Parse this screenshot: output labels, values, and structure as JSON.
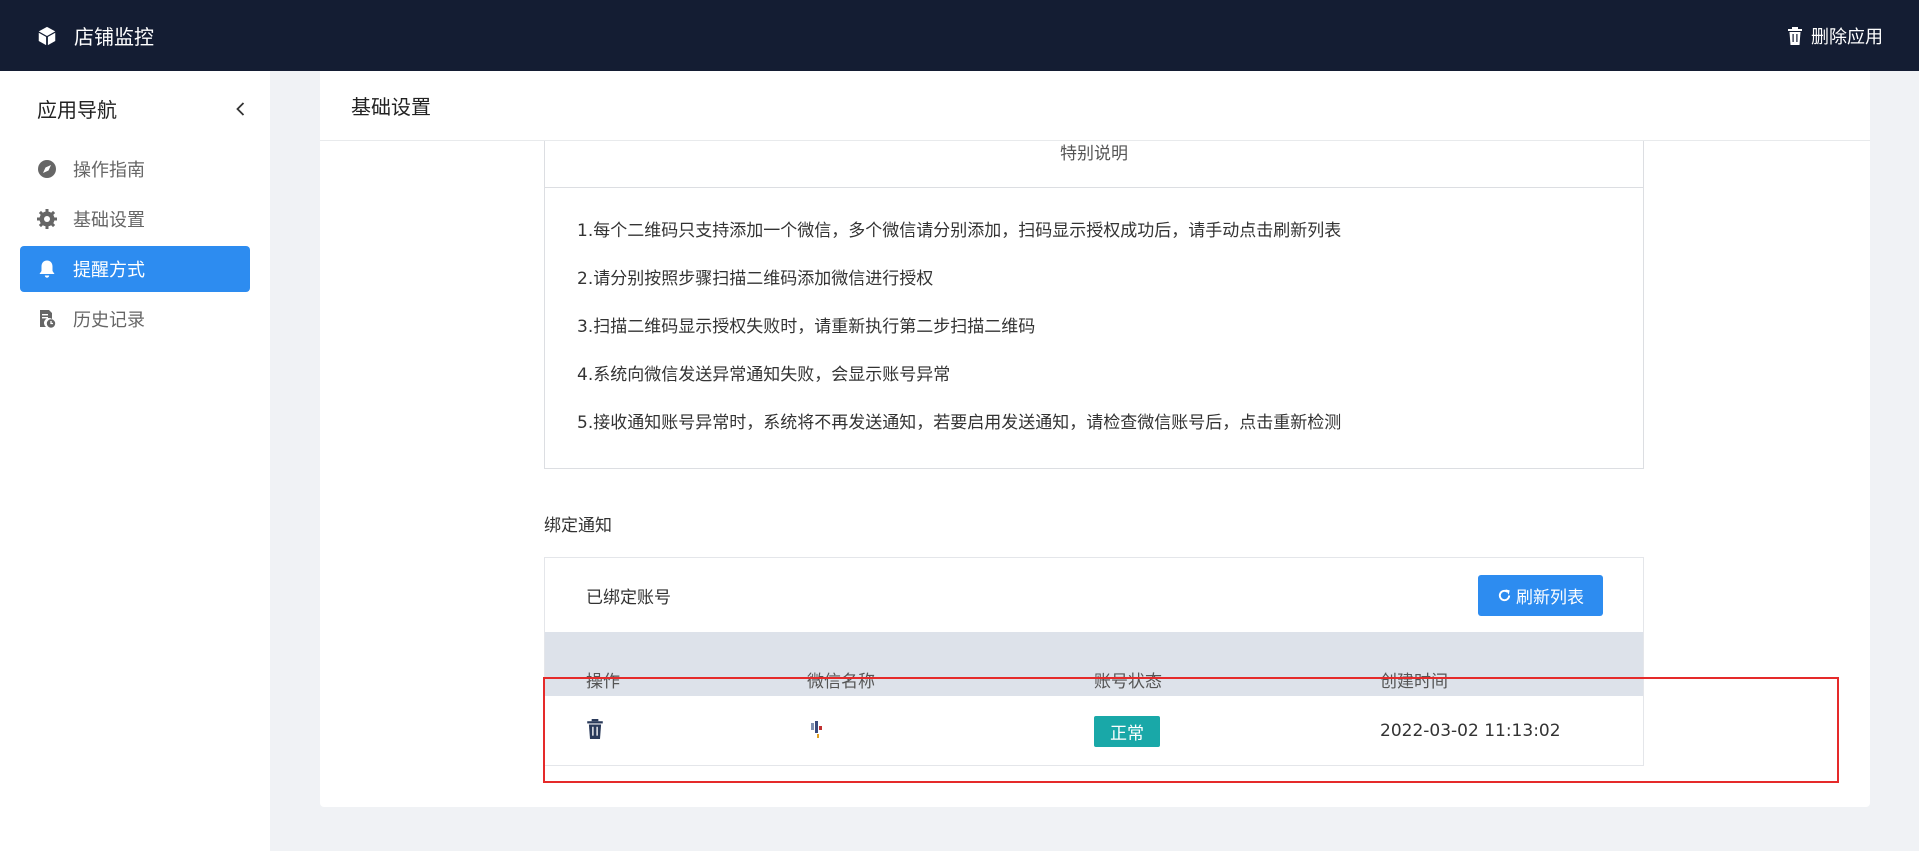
{
  "header": {
    "app_name": "店铺监控",
    "delete_app_label": "删除应用"
  },
  "sidebar": {
    "title": "应用导航",
    "items": [
      {
        "label": "操作指南",
        "icon": "navigation-icon"
      },
      {
        "label": "基础设置",
        "icon": "gear-icon"
      },
      {
        "label": "提醒方式",
        "icon": "bell-icon",
        "active": true
      },
      {
        "label": "历史记录",
        "icon": "history-doc-icon"
      }
    ]
  },
  "main": {
    "title": "基础设置",
    "notice": {
      "title": "特别说明",
      "lines": [
        "1.每个二维码只支持添加一个微信，多个微信请分别添加，扫码显示授权成功后，请手动点击刷新列表",
        "2.请分别按照步骤扫描二维码添加微信进行授权",
        "3.扫描二维码显示授权失败时，请重新执行第二步扫描二维码",
        "4.系统向微信发送异常通知失败，会显示账号异常",
        "5.接收通知账号异常时，系统将不再发送通知，若要启用发送通知，请检查微信账号后，点击重新检测"
      ]
    },
    "bind": {
      "section_title": "绑定通知",
      "bound_label": "已绑定账号",
      "refresh_label": "刷新列表",
      "columns": [
        "操作",
        "微信名称",
        "账号状态",
        "创建时间"
      ],
      "rows": [
        {
          "status": "正常",
          "created": "2022-03-02 11:13:02"
        }
      ]
    }
  },
  "colors": {
    "header_bg": "#141d33",
    "accent": "#2d8cf0",
    "status_ok": "#19a8a8",
    "highlight": "#e52a2a"
  }
}
